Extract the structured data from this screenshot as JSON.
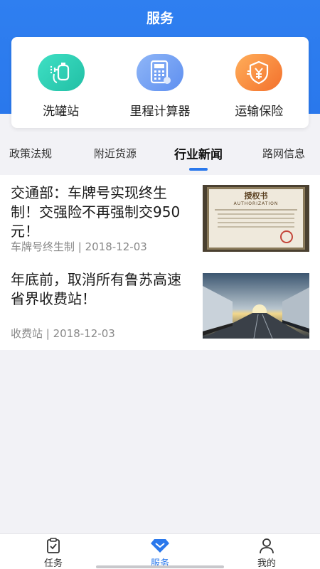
{
  "header": {
    "title": "服务"
  },
  "services": [
    {
      "label": "洗罐站",
      "icon": "spray-tank-icon",
      "color": "#26c7ab"
    },
    {
      "label": "里程计算器",
      "icon": "calculator-icon",
      "color": "#6a98f2"
    },
    {
      "label": "运输保险",
      "icon": "insurance-shield-icon",
      "color": "#f57b34"
    }
  ],
  "tabs": [
    {
      "label": "政策法规",
      "active": false
    },
    {
      "label": "附近货源",
      "active": false
    },
    {
      "label": "行业新闻",
      "active": true
    },
    {
      "label": "路网信息",
      "active": false
    }
  ],
  "news": [
    {
      "title": "交通部：车牌号实现终生制！交强险不再强制交950元！",
      "tag": "车牌号终生制",
      "date": "2018-12-03",
      "thumbnail": "authorization-certificate",
      "thumb_text": {
        "heading": "授权书",
        "sub": "AUTHORIZATION"
      }
    },
    {
      "title": "年底前，取消所有鲁苏高速省界收费站！",
      "tag": "收费站",
      "date": "2018-12-03",
      "thumbnail": "trucks-on-highway-sunset"
    }
  ],
  "tabbar": [
    {
      "label": "任务",
      "icon": "clipboard-check-icon",
      "active": false
    },
    {
      "label": "服务",
      "icon": "diamond-icon",
      "active": true
    },
    {
      "label": "我的",
      "icon": "person-icon",
      "active": false
    }
  ],
  "colors": {
    "primary": "#2a78ec",
    "background": "#f2f2f6"
  }
}
